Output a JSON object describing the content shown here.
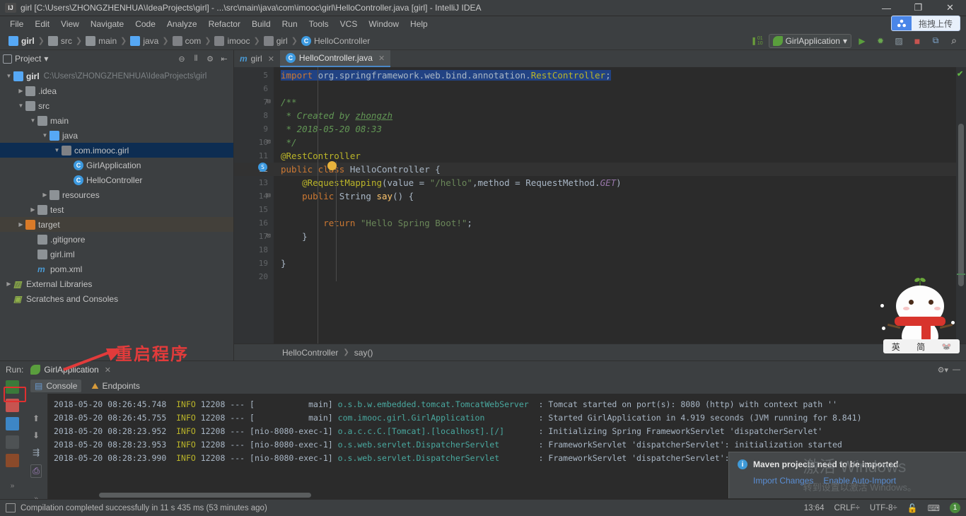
{
  "titlebar": {
    "icon": "intellij-logo-icon",
    "title": "girl [C:\\Users\\ZHONGZHENHUA\\IdeaProjects\\girl] - ...\\src\\main\\java\\com\\imooc\\girl\\HelloController.java [girl] - IntelliJ IDEA",
    "minimize": "—",
    "maximize": "❐",
    "close": "✕"
  },
  "menubar": {
    "items": [
      "File",
      "Edit",
      "View",
      "Navigate",
      "Code",
      "Analyze",
      "Refactor",
      "Build",
      "Run",
      "Tools",
      "VCS",
      "Window",
      "Help"
    ],
    "upload_button": {
      "label": "拖拽上传",
      "icon": "cloud-share-icon"
    }
  },
  "navbar": {
    "crumbs": [
      {
        "label": "girl",
        "icon": "project-icon",
        "bold": true
      },
      {
        "label": "src",
        "icon": "folder-icon"
      },
      {
        "label": "main",
        "icon": "folder-icon"
      },
      {
        "label": "java",
        "icon": "source-folder-icon"
      },
      {
        "label": "com",
        "icon": "package-icon"
      },
      {
        "label": "imooc",
        "icon": "package-icon"
      },
      {
        "label": "girl",
        "icon": "package-icon"
      },
      {
        "label": "HelloController",
        "icon": "class-icon"
      }
    ],
    "separator": "❯",
    "run_config": {
      "label": "GirlApplication",
      "icon": "spring-leaf-icon",
      "caret": "▾"
    },
    "buttons": [
      {
        "name": "run-button",
        "glyph": "▶"
      },
      {
        "name": "debug-button",
        "glyph": "✱"
      },
      {
        "name": "run-with-coverage-button",
        "glyph": "▓"
      },
      {
        "name": "stop-button",
        "glyph": "■"
      },
      {
        "name": "update-app-button",
        "glyph": "⧉"
      },
      {
        "name": "search-everywhere-button",
        "glyph": "⌕"
      }
    ],
    "binary_icon": "binary-toggle-icon"
  },
  "project_panel": {
    "title": "Project",
    "caret": "▾",
    "tools": [
      {
        "name": "collapse-all-icon",
        "glyph": "⊖"
      },
      {
        "name": "expand-all-icon",
        "glyph": "⫴"
      },
      {
        "name": "settings-icon",
        "glyph": "⚙"
      },
      {
        "name": "hide-icon",
        "glyph": "⇤"
      }
    ],
    "tree": [
      {
        "indent": 0,
        "arrow": "▼",
        "icon": "project-icon",
        "label": "girl",
        "bold": true,
        "path": "C:\\Users\\ZHONGZHENHUA\\IdeaProjects\\girl",
        "state": "normal"
      },
      {
        "indent": 1,
        "arrow": "▶",
        "icon": "folder-icon",
        "label": ".idea",
        "bold": false,
        "path": "",
        "state": "normal"
      },
      {
        "indent": 1,
        "arrow": "▼",
        "icon": "folder-icon",
        "label": "src",
        "bold": false,
        "path": "",
        "state": "normal"
      },
      {
        "indent": 2,
        "arrow": "▼",
        "icon": "folder-icon",
        "label": "main",
        "bold": false,
        "path": "",
        "state": "normal"
      },
      {
        "indent": 3,
        "arrow": "▼",
        "icon": "source-folder-icon",
        "label": "java",
        "bold": false,
        "path": "",
        "state": "normal"
      },
      {
        "indent": 4,
        "arrow": "▼",
        "icon": "package-icon",
        "label": "com.imooc.girl",
        "bold": false,
        "path": "",
        "state": "selected"
      },
      {
        "indent": 5,
        "arrow": "",
        "icon": "spring-class-icon",
        "label": "GirlApplication",
        "bold": false,
        "path": "",
        "state": "normal"
      },
      {
        "indent": 5,
        "arrow": "",
        "icon": "class-icon",
        "label": "HelloController",
        "bold": false,
        "path": "",
        "state": "normal"
      },
      {
        "indent": 3,
        "arrow": "▶",
        "icon": "resources-folder-icon",
        "label": "resources",
        "bold": false,
        "path": "",
        "state": "normal"
      },
      {
        "indent": 2,
        "arrow": "▶",
        "icon": "test-folder-icon",
        "label": "test",
        "bold": false,
        "path": "",
        "state": "normal"
      },
      {
        "indent": 1,
        "arrow": "▶",
        "icon": "target-folder-icon",
        "label": "target",
        "bold": false,
        "path": "",
        "state": "highlight"
      },
      {
        "indent": 2,
        "arrow": "",
        "icon": "file-icon",
        "label": ".gitignore",
        "bold": false,
        "path": "",
        "state": "normal"
      },
      {
        "indent": 2,
        "arrow": "",
        "icon": "iml-file-icon",
        "label": "girl.iml",
        "bold": false,
        "path": "",
        "state": "normal"
      },
      {
        "indent": 2,
        "arrow": "",
        "icon": "maven-file-icon",
        "label": "pom.xml",
        "bold": false,
        "path": "",
        "state": "normal"
      },
      {
        "indent": 0,
        "arrow": "▶",
        "icon": "libraries-icon",
        "label": "External Libraries",
        "bold": false,
        "path": "",
        "state": "normal"
      },
      {
        "indent": 0,
        "arrow": "",
        "icon": "scratches-icon",
        "label": "Scratches and Consoles",
        "bold": false,
        "path": "",
        "state": "normal"
      }
    ]
  },
  "editor": {
    "tabs": [
      {
        "label": "girl",
        "icon": "maven-file-icon",
        "active": false,
        "close": "✕"
      },
      {
        "label": "HelloController.java",
        "icon": "class-icon",
        "active": true,
        "close": "✕"
      }
    ],
    "line_numbers": [
      "5",
      "6",
      "7",
      "8",
      "9",
      "10",
      "11",
      "12",
      "13",
      "14",
      "15",
      "16",
      "17",
      "18",
      "19",
      "20"
    ],
    "current_line": "12",
    "code_lines": [
      "import org.springframework.web.bind.annotation.RestController;",
      "",
      "/**",
      " * Created by zhongzh",
      " * 2018-05-20 08:33",
      " */",
      "@RestController",
      "public class HelloController {",
      "    @RequestMapping(value = \"/hello\",method = RequestMethod.GET)",
      "    public String say() {",
      "",
      "        return \"Hello Spring Boot!\";",
      "    }",
      "",
      "}",
      ""
    ],
    "breadcrumb": {
      "class": "HelloController",
      "method": "say()",
      "separator": "❯"
    },
    "inspection_status": "ok-check-icon"
  },
  "run_panel": {
    "label": "Run:",
    "tab": {
      "label": "GirlApplication",
      "icon": "spring-leaf-icon",
      "close": "✕"
    },
    "settings_icons": [
      {
        "name": "settings-icon",
        "glyph": "⚙▾"
      },
      {
        "name": "hide-icon",
        "glyph": "—"
      }
    ],
    "toolbar": [
      {
        "name": "rerun-button",
        "glyph": "↺",
        "highlighted": true
      },
      {
        "name": "stop-button",
        "glyph": "■",
        "highlighted": false
      },
      {
        "name": "pause-button",
        "glyph": "⏸",
        "highlighted": false
      },
      {
        "name": "dump-threads-button",
        "glyph": "◎",
        "highlighted": false
      },
      {
        "name": "trace-button",
        "glyph": "✴",
        "highlighted": false
      }
    ],
    "side_toolbar": [
      {
        "name": "scroll-up-button",
        "glyph": "⬆"
      },
      {
        "name": "scroll-down-button",
        "glyph": "⬇"
      },
      {
        "name": "soft-wrap-button",
        "glyph": "☰"
      },
      {
        "name": "print-button",
        "glyph": "⎙"
      }
    ],
    "console_tabs": [
      {
        "label": "Console",
        "icon": "console-icon",
        "active": true
      },
      {
        "label": "Endpoints",
        "icon": "endpoints-icon",
        "active": false
      }
    ],
    "log_lines": [
      {
        "ts": "2018-05-20 08:26:45.748",
        "level": "INFO",
        "pid": "12208",
        "dash": "---",
        "thread": "[           main]",
        "cls": "o.s.b.w.embedded.tomcat.TomcatWebServer  ",
        "msg": ": Tomcat started on port(s): 8080 (http) with context path ''"
      },
      {
        "ts": "2018-05-20 08:26:45.755",
        "level": "INFO",
        "pid": "12208",
        "dash": "---",
        "thread": "[           main]",
        "cls": "com.imooc.girl.GirlApplication           ",
        "msg": ": Started GirlApplication in 4.919 seconds (JVM running for 8.841)"
      },
      {
        "ts": "2018-05-20 08:28:23.952",
        "level": "INFO",
        "pid": "12208",
        "dash": "---",
        "thread": "[nio-8080-exec-1]",
        "cls": "o.a.c.c.C.[Tomcat].[localhost].[/]       ",
        "msg": ": Initializing Spring FrameworkServlet 'dispatcherServlet'"
      },
      {
        "ts": "2018-05-20 08:28:23.953",
        "level": "INFO",
        "pid": "12208",
        "dash": "---",
        "thread": "[nio-8080-exec-1]",
        "cls": "o.s.web.servlet.DispatcherServlet        ",
        "msg": ": FrameworkServlet 'dispatcherServlet': initialization started"
      },
      {
        "ts": "2018-05-20 08:28:23.990",
        "level": "INFO",
        "pid": "12208",
        "dash": "---",
        "thread": "[nio-8080-exec-1]",
        "cls": "o.s.web.servlet.DispatcherServlet        ",
        "msg": ": FrameworkServlet 'dispatcherServlet': initialization completed"
      }
    ]
  },
  "statusbar": {
    "message": "Compilation completed successfully in 11 s 435 ms (53 minutes ago)",
    "caret_position": "13:64",
    "line_separator": "CRLF÷",
    "encoding": "UTF-8÷",
    "lock_icon": "readonly-lock-icon",
    "inspector_icon": "inspector-icon",
    "notification_count": "1"
  },
  "maven_popup": {
    "title": "Maven projects need to be imported",
    "icon": "info-icon",
    "links": [
      "Import Changes",
      "Enable Auto-Import"
    ]
  },
  "windows_watermark": {
    "line1": "激活 Windows",
    "line2": "转到设置以激活 Windows。"
  },
  "annotation": {
    "text": "重启程序",
    "color": "#e23b3b"
  },
  "ime_widget": {
    "mode_en": "英",
    "mode_simplified": "简",
    "menu_icon": "sogou-mascot-icon"
  },
  "colors": {
    "background": "#3c3f41",
    "editor_bg": "#2b2b2b",
    "selection": "#0d2d52",
    "accent": "#4a88c7",
    "annotation_red": "#e23b3b"
  }
}
